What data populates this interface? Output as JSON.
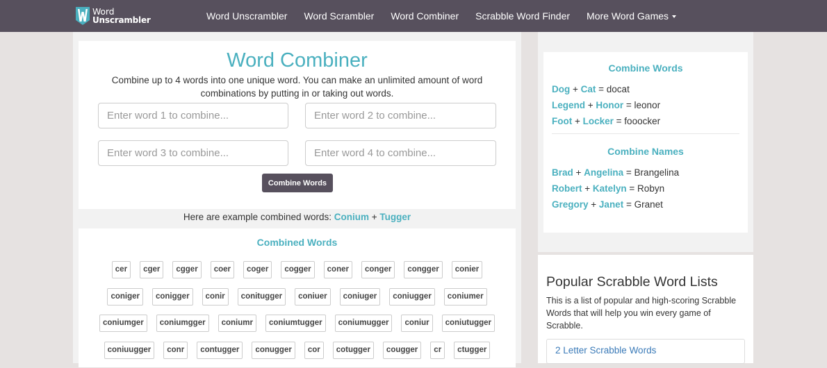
{
  "brand": {
    "line1": "Word",
    "line2": "Unscrambler",
    "logo_icon": "w-shield-logo",
    "colors": {
      "logo_bg": "#4ab0bf",
      "nav_bg": "#57505d"
    }
  },
  "nav": {
    "items": [
      {
        "label": "Word Unscrambler"
      },
      {
        "label": "Word Scrambler"
      },
      {
        "label": "Word Combiner"
      },
      {
        "label": "Scrabble Word Finder"
      },
      {
        "label": "More Word Games",
        "has_dropdown": true,
        "icon": "caret-down-icon"
      }
    ]
  },
  "main": {
    "title": "Word Combiner",
    "intro": "Combine up to 4 words into one unique word. You can make an unlimited amount of word combinations by putting in or taking out words.",
    "inputs": [
      {
        "value": "",
        "placeholder": "Enter word 1 to combine..."
      },
      {
        "value": "",
        "placeholder": "Enter word 2 to combine..."
      },
      {
        "value": "",
        "placeholder": "Enter word 3 to combine..."
      },
      {
        "value": "",
        "placeholder": "Enter word 4 to combine..."
      }
    ],
    "combine_button": "Combine Words",
    "example": {
      "prefix": "Here are example combined words: ",
      "word1": "Conium",
      "plus": " + ",
      "word2": "Tugger"
    },
    "results_title": "Combined Words",
    "results_rows": [
      [
        "cer",
        "cger",
        "cgger",
        "coer",
        "coger",
        "cogger",
        "coner",
        "conger",
        "congger",
        "conier"
      ],
      [
        "coniger",
        "conigger",
        "conir",
        "conitugger",
        "coniuer",
        "coniuger",
        "coniugger",
        "coniumer"
      ],
      [
        "coniumger",
        "coniumgger",
        "coniumr",
        "coniumtugger",
        "coniumugger",
        "coniur",
        "coniutugger"
      ],
      [
        "coniuugger",
        "conr",
        "contugger",
        "conugger",
        "cor",
        "cotugger",
        "cougger",
        "cr",
        "ctugger"
      ]
    ]
  },
  "sidebar": {
    "combine_words": {
      "heading": "Combine Words",
      "items": [
        {
          "a": "Dog",
          "b": "Cat",
          "result": "docat"
        },
        {
          "a": "Legend",
          "b": "Honor",
          "result": "leonor"
        },
        {
          "a": "Foot",
          "b": "Locker",
          "result": "fooocker"
        }
      ]
    },
    "combine_names": {
      "heading": "Combine Names",
      "items": [
        {
          "a": "Brad",
          "b": "Angelina",
          "result": "Brangelina"
        },
        {
          "a": "Robert",
          "b": "Katelyn",
          "result": "Robyn"
        },
        {
          "a": "Gregory",
          "b": "Janet",
          "result": "Granet"
        }
      ]
    },
    "popular": {
      "title": "Popular Scrabble Word Lists",
      "description": "This is a list of popular and high-scoring Scrabble Words that will help you win every game of Scrabble.",
      "items": [
        {
          "label": "2 Letter Scrabble Words"
        }
      ]
    }
  },
  "accent_color": "#4ab0bf",
  "link_color": "#3a7ab8"
}
